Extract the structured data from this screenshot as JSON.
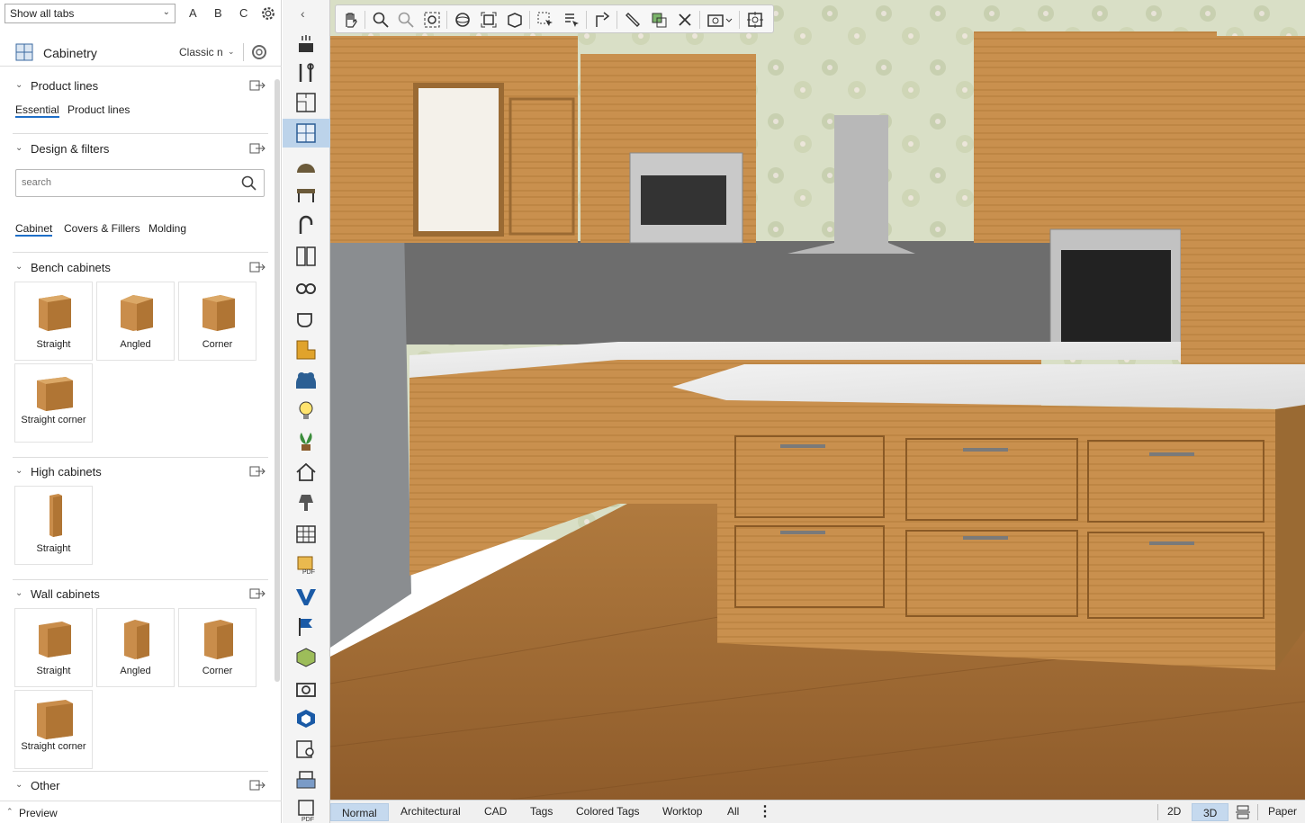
{
  "topbar": {
    "tab_filter": "Show all tabs",
    "letters": [
      "A",
      "B",
      "C"
    ]
  },
  "catalog": {
    "name": "Cabinetry",
    "style": "Classic n"
  },
  "sections": {
    "product_lines": "Product lines",
    "product_tabs": [
      "Essential",
      "Product lines"
    ],
    "design_filters": "Design & filters",
    "search_placeholder": "search",
    "type_tabs": [
      "Cabinet",
      "Covers & Fillers",
      "Molding"
    ],
    "bench": "Bench cabinets",
    "bench_items": [
      "Straight",
      "Angled",
      "Corner",
      "Straight corner"
    ],
    "high": "High cabinets",
    "high_items": [
      "Straight"
    ],
    "wall": "Wall cabinets",
    "wall_items": [
      "Straight",
      "Angled",
      "Corner",
      "Straight corner"
    ],
    "other": "Other"
  },
  "preview": {
    "label": "Preview"
  },
  "views": {
    "modes": [
      "Normal",
      "Architectural",
      "CAD",
      "Tags",
      "Colored Tags",
      "Worktop",
      "All"
    ],
    "active_mode": "Normal",
    "dims": [
      "2D",
      "3D"
    ],
    "active_dim": "3D",
    "paper": "Paper"
  },
  "colors": {
    "accent": "#1e6fc8",
    "selected_bg": "#c5d9ee",
    "wood": "#c48a45"
  }
}
